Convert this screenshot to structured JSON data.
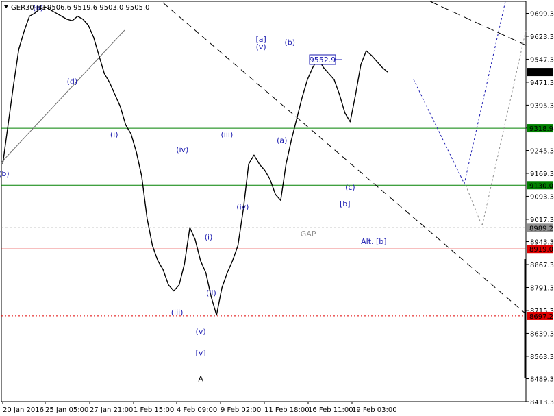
{
  "header": {
    "symbol": "GER30-H1",
    "ohlc": "9506.6 9519.6 9503.0 9505.0"
  },
  "colors": {
    "background": "#ffffff",
    "price_line": "#000000",
    "wave_label": "#1a1ab0",
    "support_line": "#008000",
    "red_line": "#e00000",
    "gap_line": "#909090",
    "projection_blue": "#1a1ab0",
    "projection_gray": "#909090",
    "current_tag": "#000000",
    "green_tag": "#008000",
    "red_tag": "#e00000",
    "gray_tag": "#909090"
  },
  "chart_data": {
    "type": "line",
    "title": "GER30-H1",
    "ylim": [
      8413.3,
      9739
    ],
    "y_ticks": [
      9699.3,
      9623.3,
      9547.3,
      9471.3,
      9395.3,
      9319.3,
      9245.3,
      9169.3,
      9093.3,
      9017.3,
      8943.3,
      8867.3,
      8791.3,
      8715.3,
      8639.3,
      8563.3,
      8489.3,
      8413.3
    ],
    "y_tick_labels": [
      "9699.3",
      "9623.3",
      "9547.3",
      "9471.3",
      "9395.3",
      "9319.3",
      "9245.3",
      "9169.3",
      "9093.3",
      "9017.3",
      "8943.3",
      "8867.3",
      "8791.3",
      "8715.3",
      "8639.3",
      "8563.3",
      "8489.3",
      "8413.3"
    ],
    "x_tick_labels": [
      "20 Jan 2016",
      "25 Jan 05:00",
      "27 Jan 21:00",
      "1 Feb 15:00",
      "4 Feb 09:00",
      "9 Feb 02:00",
      "11 Feb 18:00",
      "16 Feb 11:00",
      "19 Feb 03:00"
    ],
    "series": [
      {
        "values": [
          9200,
          9330,
          9460,
          9580,
          9640,
          9690,
          9700,
          9715,
          9720,
          9710,
          9700,
          9690,
          9680,
          9675,
          9690,
          9680,
          9660,
          9620,
          9560,
          9500,
          9470,
          9430,
          9390,
          9330,
          9300,
          9240,
          9160,
          9020,
          8930,
          8880,
          8850,
          8800,
          8780,
          8800,
          8870,
          8990,
          8950,
          8880,
          8840,
          8760,
          8700,
          8790,
          8840,
          8880,
          8930,
          9050,
          9200,
          9230,
          9200,
          9180,
          9150,
          9100,
          9080,
          9200,
          9280,
          9350,
          9420,
          9480,
          9520,
          9550,
          9520,
          9500,
          9480,
          9430,
          9370,
          9340,
          9430,
          9530,
          9575,
          9560,
          9540,
          9520,
          9505
        ]
      }
    ],
    "horizontal_lines": [
      {
        "value": 9505.0,
        "label": "9505.0",
        "kind": "current"
      },
      {
        "value": 9318.9,
        "label": "9318.9",
        "kind": "green"
      },
      {
        "value": 9130.0,
        "label": "9130.0",
        "kind": "green"
      },
      {
        "value": 8989.2,
        "label": "8989.2",
        "kind": "gray-dashed"
      },
      {
        "value": 8919.0,
        "label": "8919.0",
        "kind": "red"
      },
      {
        "value": 8697.2,
        "label": "8697.2",
        "kind": "red-dashed"
      }
    ],
    "callout": "9552.9",
    "wave_labels": [
      {
        "text": "(ii)",
        "x": 7,
        "y": 9710
      },
      {
        "text": "[a]",
        "x": 49.5,
        "y": 9605
      },
      {
        "text": "(b)",
        "x": 55,
        "y": 9595
      },
      {
        "text": "(v)",
        "x": 49.5,
        "y": 9580
      },
      {
        "text": "(d)",
        "x": 13.5,
        "y": 9465
      },
      {
        "text": "(b)",
        "x": 0.5,
        "y": 9160
      },
      {
        "text": "(i)",
        "x": 21.5,
        "y": 9290
      },
      {
        "text": "(iii)",
        "x": 43,
        "y": 9290
      },
      {
        "text": "(iv)",
        "x": 34.5,
        "y": 9240
      },
      {
        "text": "(a)",
        "x": 53.5,
        "y": 9270
      },
      {
        "text": "(c)",
        "x": 66.5,
        "y": 9115
      },
      {
        "text": "[b]",
        "x": 65.5,
        "y": 9060
      },
      {
        "text": "GAP",
        "x": 58.5,
        "y": 8960
      },
      {
        "text": "(iv)",
        "x": 46,
        "y": 9050
      },
      {
        "text": "(i)",
        "x": 39.5,
        "y": 8950
      },
      {
        "text": "Alt. [b]",
        "x": 71,
        "y": 8935
      },
      {
        "text": "(iii)",
        "x": 33.5,
        "y": 8700
      },
      {
        "text": "(ii)",
        "x": 40,
        "y": 8765
      },
      {
        "text": "(v)",
        "x": 38,
        "y": 8637
      },
      {
        "text": "[v]",
        "x": 38,
        "y": 8567
      },
      {
        "text": "A",
        "x": 38,
        "y": 8480
      }
    ]
  }
}
